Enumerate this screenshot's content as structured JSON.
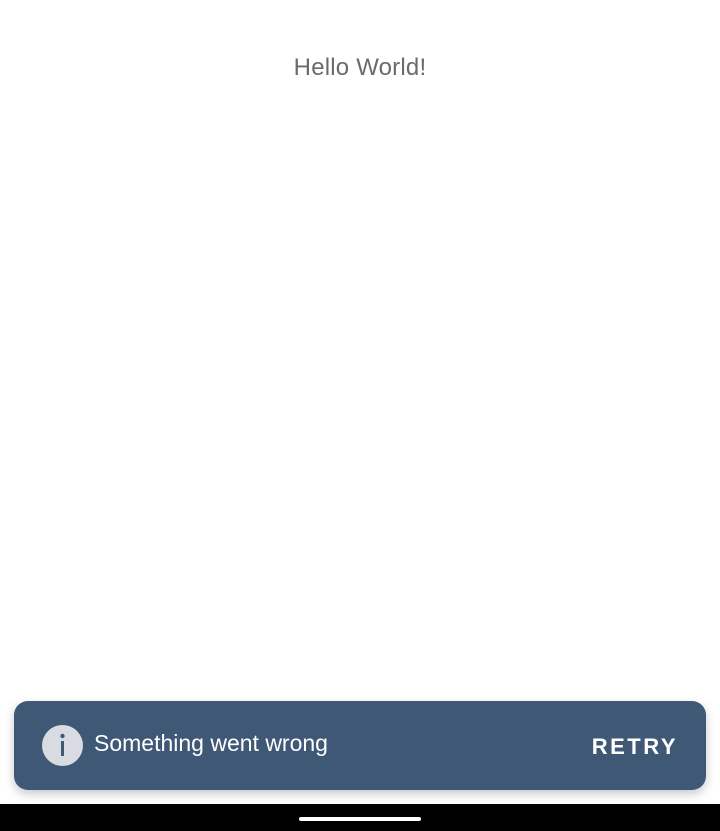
{
  "main": {
    "greeting": "Hello World!"
  },
  "snackbar": {
    "icon": "info-icon",
    "message": "Something went wrong",
    "action_label": "RETRY",
    "background_color": "#3f5876"
  },
  "system_nav": {
    "handle": "home-gesture-handle"
  }
}
